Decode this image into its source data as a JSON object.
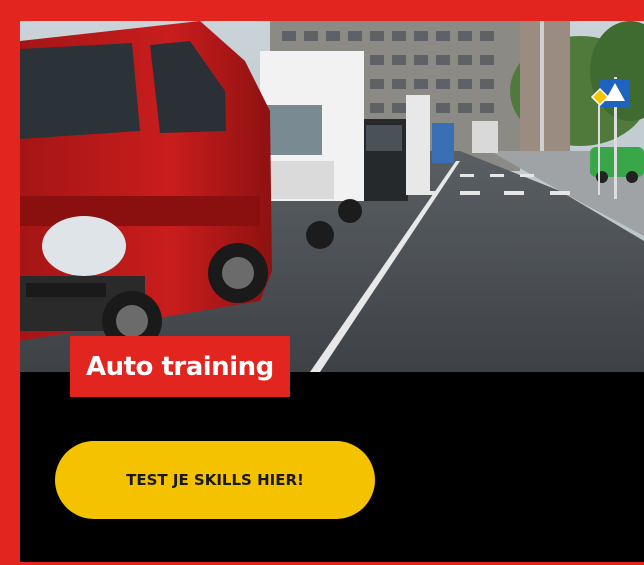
{
  "card": {
    "title": "Auto training",
    "cta_label": "TEST JE SKILLS HIER!"
  },
  "colors": {
    "brand_red": "#e3251f",
    "cta_yellow": "#f5c200",
    "background": "#000000"
  },
  "icons": {
    "scene": "street-scene-image",
    "road_sign": "pedestrian-crossing-sign"
  }
}
